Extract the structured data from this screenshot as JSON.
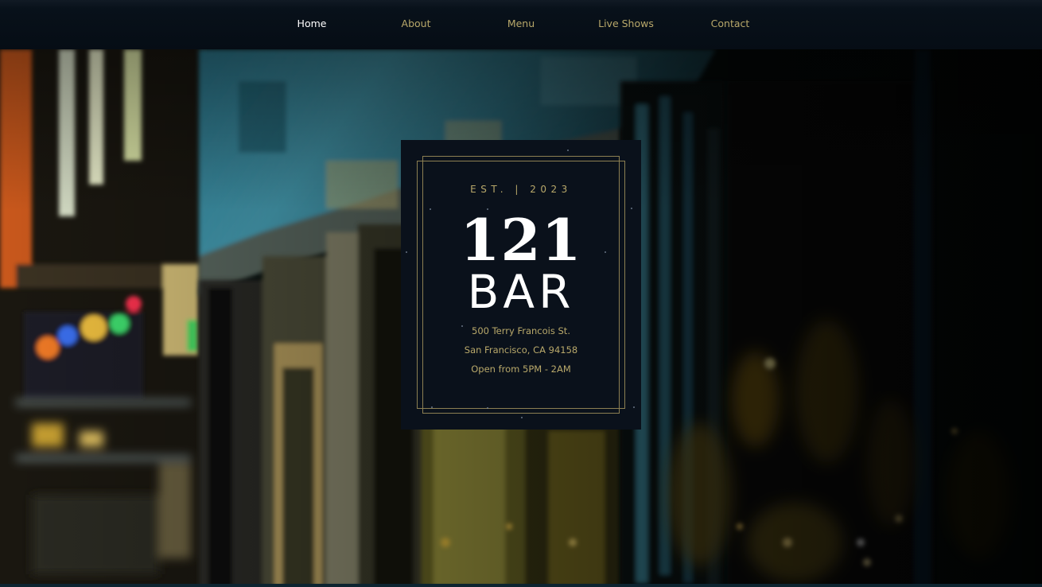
{
  "nav": {
    "items": [
      {
        "label": "Home",
        "active": true
      },
      {
        "label": "About",
        "active": false
      },
      {
        "label": "Menu",
        "active": false
      },
      {
        "label": "Live Shows",
        "active": false
      },
      {
        "label": "Contact",
        "active": false
      }
    ]
  },
  "sign": {
    "established": "EST.  |  2023",
    "number": "121",
    "word": "BAR",
    "address_line1": "500 Terry Francois St.",
    "address_line2": "San Francisco, CA 94158",
    "hours": "Open from 5PM - 2AM"
  },
  "colors": {
    "nav_background": "#060d15",
    "nav_text": "#b8a86a",
    "nav_active_text": "#ffffff",
    "card_background": "#0a111b",
    "accent_gold": "#b8a86a",
    "frame_gold": "#8c7f52"
  }
}
